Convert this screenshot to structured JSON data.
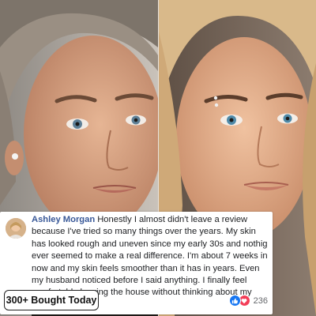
{
  "review": {
    "name": "Ashley Morgan",
    "text": "Honestly I almost didn't leave a review because I've tried so many things over the years. My skin has looked rough and uneven since my early 30s and nothig ever seemed to make a real difference. I'm about 7 weeks in now and my skin feels smoother than it has in years. Even my husband noticed before I said anything. I finally feel comfortable leaving the house without thinking about my skin all day.",
    "reaction_count": "236",
    "reaction_icons": [
      "like-icon",
      "love-icon"
    ]
  },
  "badge": {
    "label": "300+ Bought Today"
  },
  "colors": {
    "name_link": "#385898",
    "like": "#1877f2",
    "love": "#f33e58"
  }
}
